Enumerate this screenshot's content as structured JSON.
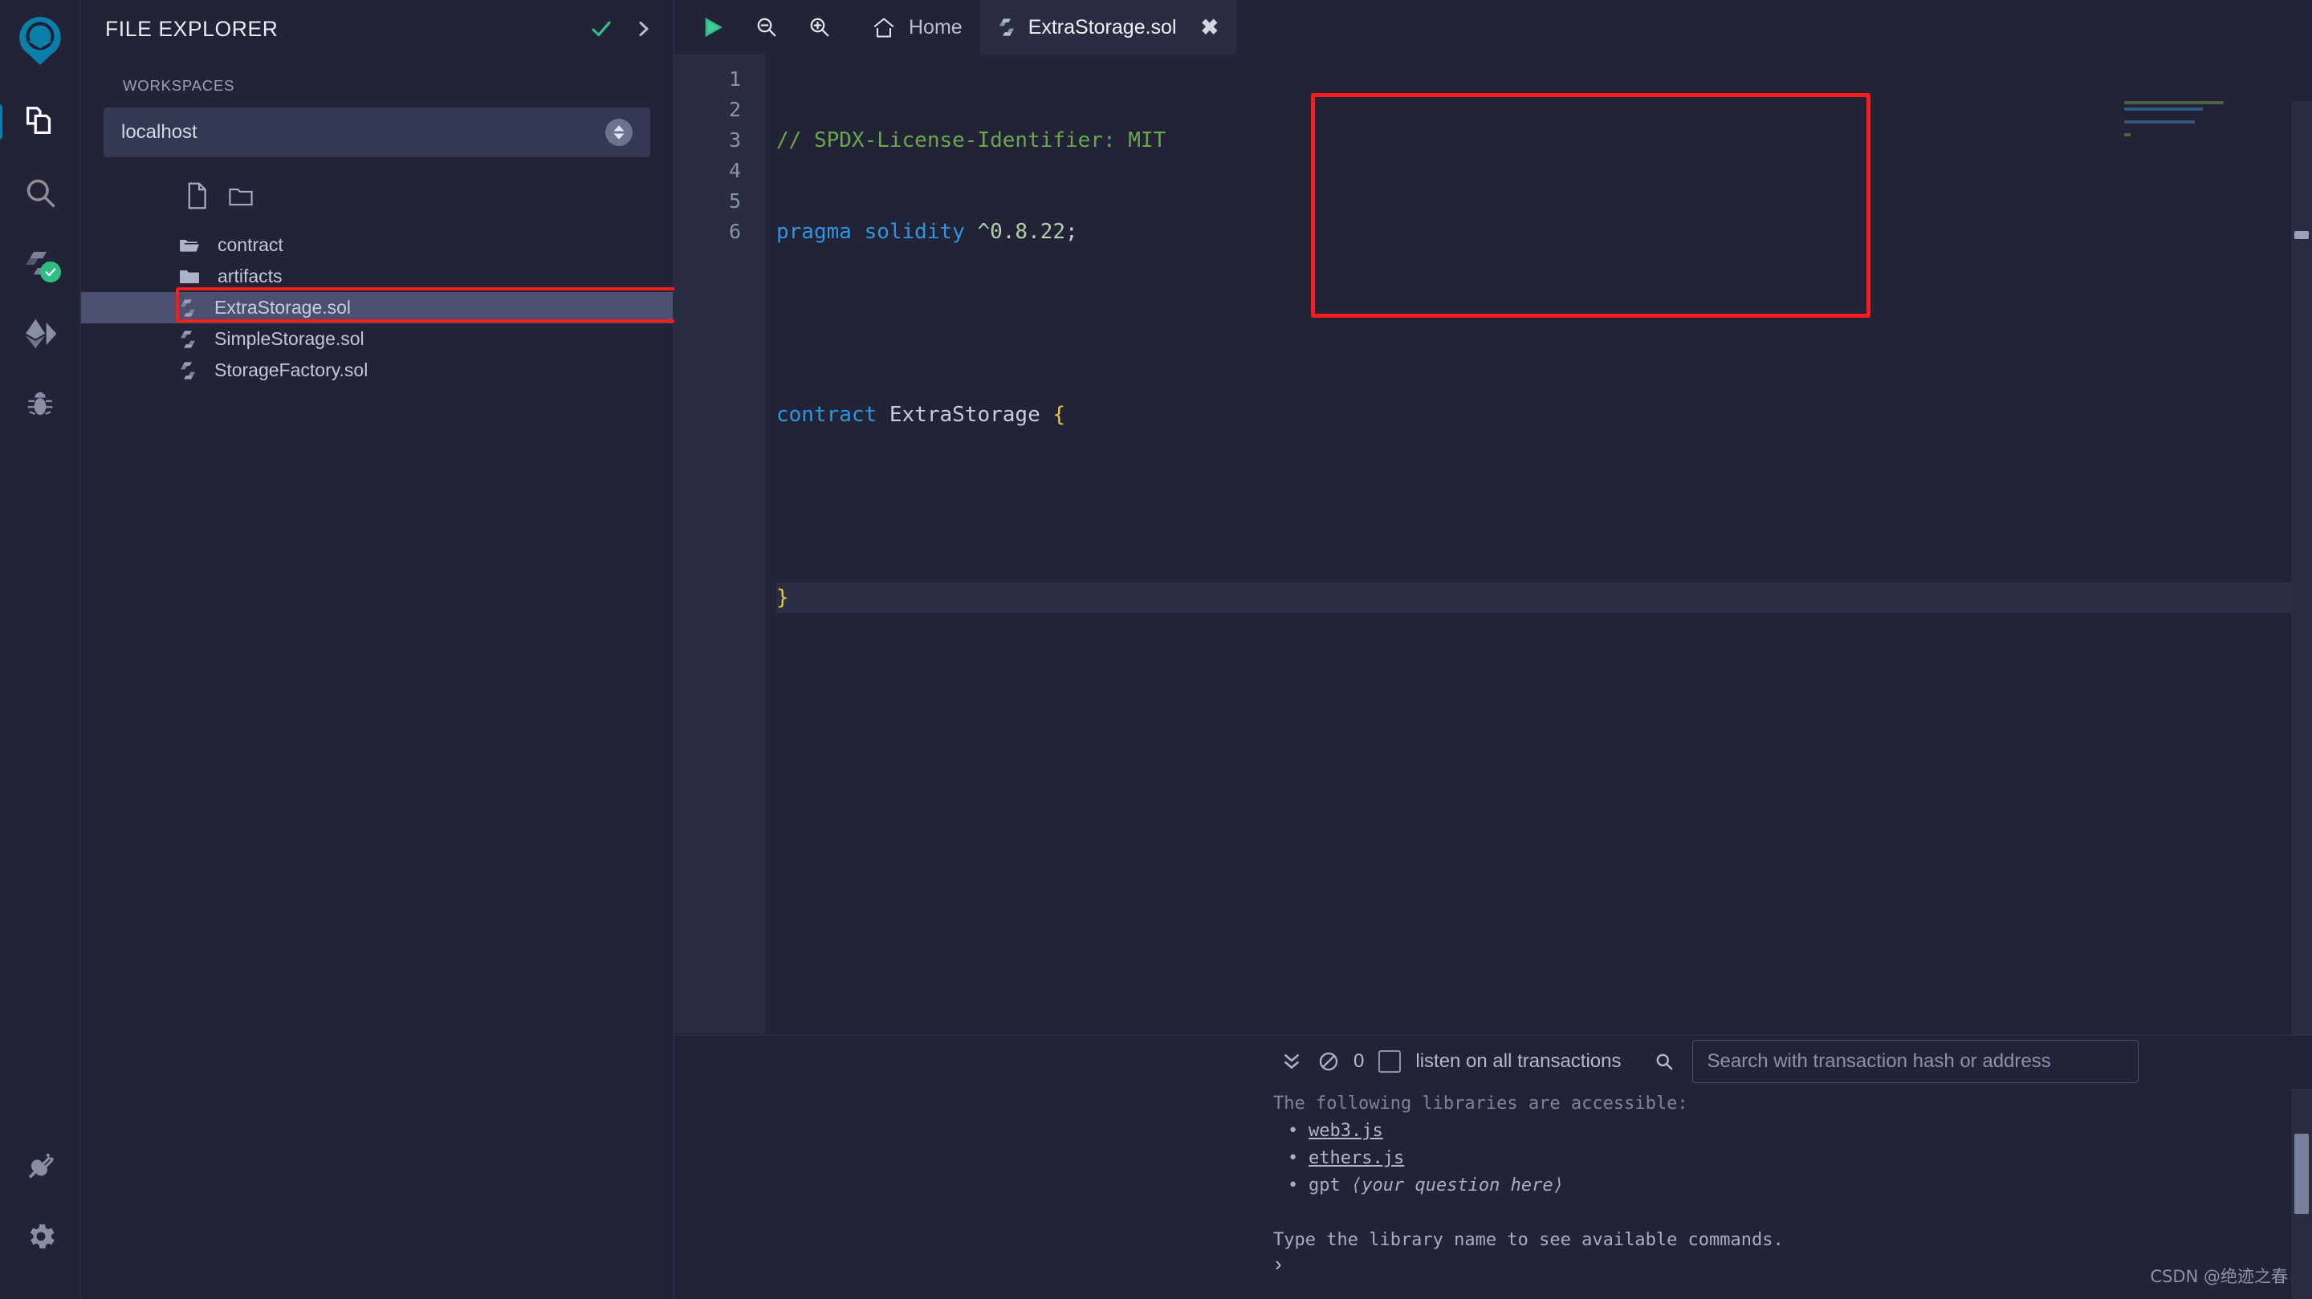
{
  "app": {
    "name": "Remix IDE",
    "watermark": "CSDN @绝迹之春"
  },
  "rail": {
    "logo_icon": "remix-logo-icon",
    "items": [
      {
        "id": "file-explorer",
        "icon": "files-icon",
        "active": true
      },
      {
        "id": "search",
        "icon": "search-icon",
        "active": false
      },
      {
        "id": "solidity-compiler",
        "icon": "solidity-icon",
        "active": false,
        "badge": "compiled-check"
      },
      {
        "id": "deploy-run",
        "icon": "ethereum-icon",
        "active": false
      },
      {
        "id": "debugger",
        "icon": "bug-icon",
        "active": false
      }
    ],
    "bottom_items": [
      {
        "id": "plugin-manager",
        "icon": "plug-icon"
      },
      {
        "id": "settings",
        "icon": "gear-icon"
      }
    ]
  },
  "explorer": {
    "title": "FILE EXPLORER",
    "head_icons": [
      {
        "id": "check",
        "icon": "check-icon"
      },
      {
        "id": "expand",
        "icon": "chevron-right-icon"
      }
    ],
    "workspaces_label": "WORKSPACES",
    "workspace_value": "localhost",
    "tools": [
      {
        "id": "new-file",
        "icon": "new-file-icon"
      },
      {
        "id": "new-folder",
        "icon": "new-folder-icon"
      }
    ],
    "tree": [
      {
        "name": "contract",
        "type": "folder-open",
        "selected": false,
        "indent": 0
      },
      {
        "name": "artifacts",
        "type": "folder",
        "selected": false,
        "indent": 0
      },
      {
        "name": "ExtraStorage.sol",
        "type": "solidity",
        "selected": true,
        "indent": 0
      },
      {
        "name": "SimpleStorage.sol",
        "type": "solidity",
        "selected": false,
        "indent": 0
      },
      {
        "name": "StorageFactory.sol",
        "type": "solidity",
        "selected": false,
        "indent": 0
      }
    ]
  },
  "tabbar": {
    "tools": [
      {
        "id": "run",
        "icon": "play-icon"
      },
      {
        "id": "zoom-out",
        "icon": "zoom-out-icon"
      },
      {
        "id": "zoom-in",
        "icon": "zoom-in-icon"
      }
    ],
    "tabs": [
      {
        "id": "home",
        "label": "Home",
        "icon": "home-icon",
        "active": false,
        "closable": false
      },
      {
        "id": "extrastorage",
        "label": "ExtraStorage.sol",
        "icon": "solidity-icon",
        "active": true,
        "closable": true,
        "close_label": "✖"
      }
    ]
  },
  "editor": {
    "language": "solidity",
    "filename": "ExtraStorage.sol",
    "lines": [
      {
        "n": "1",
        "tokens": [
          {
            "t": "// SPDX-License-Identifier: MIT",
            "c": "comment"
          }
        ]
      },
      {
        "n": "2",
        "tokens": [
          {
            "t": "pragma solidity ",
            "c": "key"
          },
          {
            "t": "^0.8.22",
            "c": "num"
          },
          {
            "t": ";",
            "c": "plain"
          }
        ]
      },
      {
        "n": "3",
        "tokens": [
          {
            "t": "",
            "c": "plain"
          }
        ]
      },
      {
        "n": "4",
        "tokens": [
          {
            "t": "contract ",
            "c": "key"
          },
          {
            "t": "ExtraStorage ",
            "c": "type"
          },
          {
            "t": "{",
            "c": "brace"
          }
        ]
      },
      {
        "n": "5",
        "tokens": [
          {
            "t": "",
            "c": "plain"
          }
        ]
      },
      {
        "n": "6",
        "tokens": [
          {
            "t": "}",
            "c": "brace"
          }
        ],
        "current": true
      }
    ]
  },
  "terminal": {
    "toggle_icon": "chevron-double-down-icon",
    "clear_icon": "ban-icon",
    "count": "0",
    "listen_checkbox_checked": false,
    "listen_label": "listen on all transactions",
    "search_icon": "search-icon",
    "search_placeholder": "Search with transaction hash or address",
    "output": {
      "clipped_line": "The following libraries are accessible:",
      "items": [
        {
          "text": "web3.js",
          "link": true
        },
        {
          "text": "ethers.js",
          "link": true
        },
        {
          "text": "gpt ",
          "link": false,
          "em": "⟨your question here⟩"
        }
      ],
      "hint": "Type the library name to see available commands."
    },
    "prompt": "›"
  },
  "colors": {
    "bg": "#222336",
    "panel": "#2a2c42",
    "accent": "#0b7fa8",
    "selection": "#4b5070",
    "highlight_outline": "#f91d1d",
    "success": "#2ebd85",
    "comment": "#6aa84f",
    "keyword": "#2f96dd",
    "number": "#b5cea8",
    "brace": "#e6c545"
  }
}
